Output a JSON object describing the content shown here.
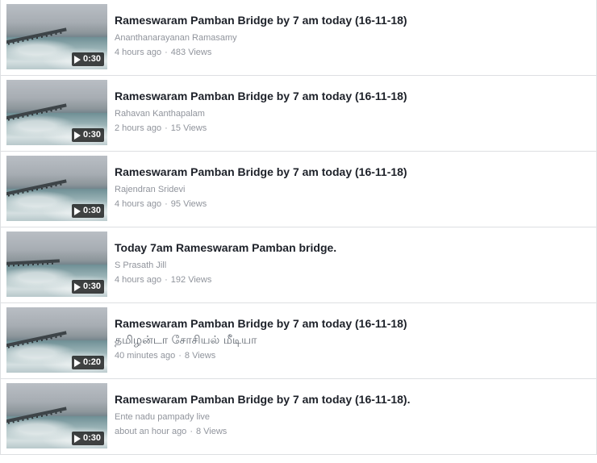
{
  "videos": [
    {
      "title": "Rameswaram Pamban Bridge by 7 am today (16-11-18)",
      "channel": "Ananthanarayanan Ramasamy",
      "time": "4 hours ago",
      "views": "483 Views",
      "duration": "0:30"
    },
    {
      "title": "Rameswaram Pamban Bridge by 7 am today (16-11-18)",
      "channel": "Rahavan Kanthapalam",
      "time": "2 hours ago",
      "views": "15 Views",
      "duration": "0:30"
    },
    {
      "title": "Rameswaram Pamban Bridge by 7 am today (16-11-18)",
      "channel": "Rajendran Sridevi",
      "time": "4 hours ago",
      "views": "95 Views",
      "duration": "0:30"
    },
    {
      "title": "Today 7am Rameswaram Pamban bridge.",
      "channel": "S Prasath Jill",
      "time": "4 hours ago",
      "views": "192 Views",
      "duration": "0:30"
    },
    {
      "title": "Rameswaram Pamban Bridge by 7 am today (16-11-18)",
      "channel": "தமிழன்டா சோசியல் மீடியா",
      "time": "40 minutes ago",
      "views": "8 Views",
      "duration": "0:20"
    },
    {
      "title": "Rameswaram Pamban Bridge by 7 am today (16-11-18).",
      "channel": "Ente nadu pampady live",
      "time": "about an hour ago",
      "views": "8 Views",
      "duration": "0:30"
    }
  ],
  "separator": "·",
  "icons": {
    "play": "play-icon"
  }
}
